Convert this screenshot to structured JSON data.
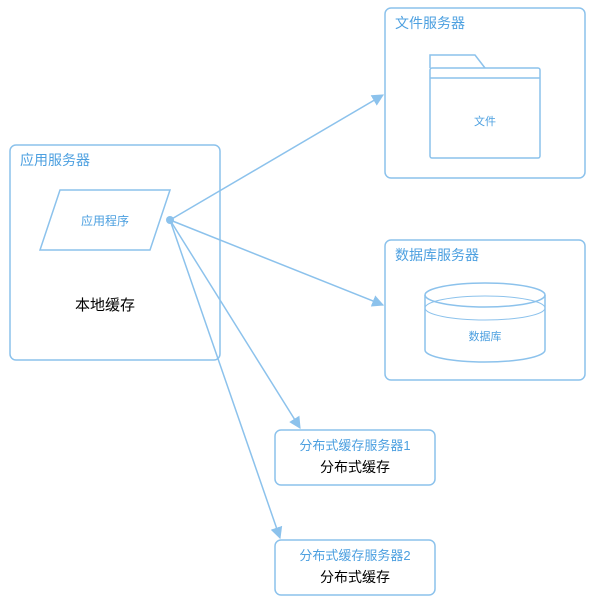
{
  "colors": {
    "stroke": "#8cc2ec",
    "text_blue": "#4da0e0",
    "text_black": "#000000"
  },
  "nodes": {
    "app_server": {
      "title": "应用服务器",
      "app_label": "应用程序",
      "cache_label": "本地缓存"
    },
    "file_server": {
      "title": "文件服务器",
      "folder_label": "文件"
    },
    "db_server": {
      "title": "数据库服务器",
      "db_label": "数据库"
    },
    "dist_cache1": {
      "title": "分布式缓存服务器1",
      "label": "分布式缓存"
    },
    "dist_cache2": {
      "title": "分布式缓存服务器2",
      "label": "分布式缓存"
    }
  }
}
